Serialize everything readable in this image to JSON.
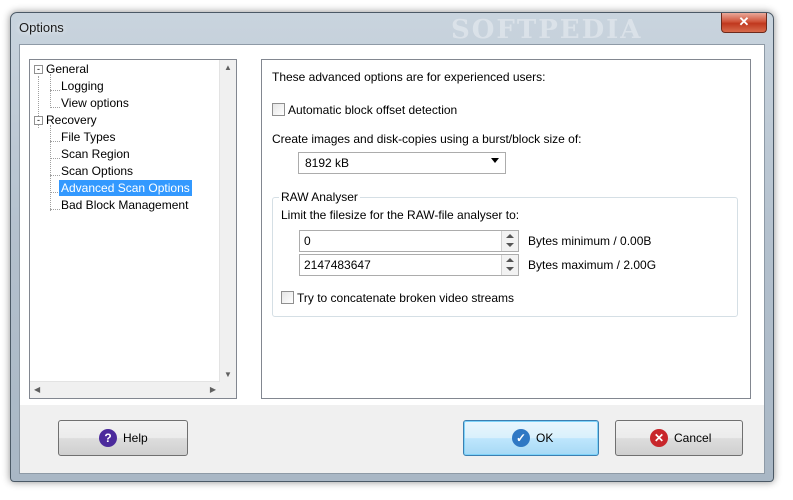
{
  "window": {
    "title": "Options",
    "watermark": "SOFTPEDIA",
    "close_glyph": "✕"
  },
  "tree": {
    "items": [
      {
        "label": "General",
        "expander": "-"
      },
      {
        "label": "Logging"
      },
      {
        "label": "View options"
      },
      {
        "label": "Recovery",
        "expander": "-"
      },
      {
        "label": "File Types"
      },
      {
        "label": "Scan Region"
      },
      {
        "label": "Scan Options"
      },
      {
        "label": "Advanced Scan Options",
        "selected": true
      },
      {
        "label": "Bad Block Management"
      }
    ],
    "scroll_up": "▲",
    "scroll_down": "▼",
    "scroll_left": "◀",
    "scroll_right": "▶"
  },
  "panel": {
    "intro": "These advanced options are for experienced users:",
    "auto_block_offset_label": "Automatic block offset detection",
    "auto_block_offset_checked": false,
    "burst_label": "Create images and disk-copies using a burst/block size of:",
    "burst_value": "8192 kB",
    "raw_group_title": "RAW Analyser",
    "raw_limit_label": "Limit the filesize for the RAW-file analyser to:",
    "min_value": "0",
    "min_label": "Bytes minimum / 0.00B",
    "max_value": "2147483647",
    "max_label": "Bytes maximum / 2.00G",
    "concat_label": "Try to concatenate broken video streams",
    "concat_checked": false
  },
  "buttons": {
    "help": "Help",
    "ok": "OK",
    "cancel": "Cancel",
    "help_icon": "?",
    "ok_icon": "✓",
    "cancel_icon": "✕"
  },
  "colors": {
    "selection": "#3399ff",
    "help_icon": "#4b2a9c",
    "ok_icon": "#2f78c4",
    "cancel_icon": "#c8262b"
  }
}
